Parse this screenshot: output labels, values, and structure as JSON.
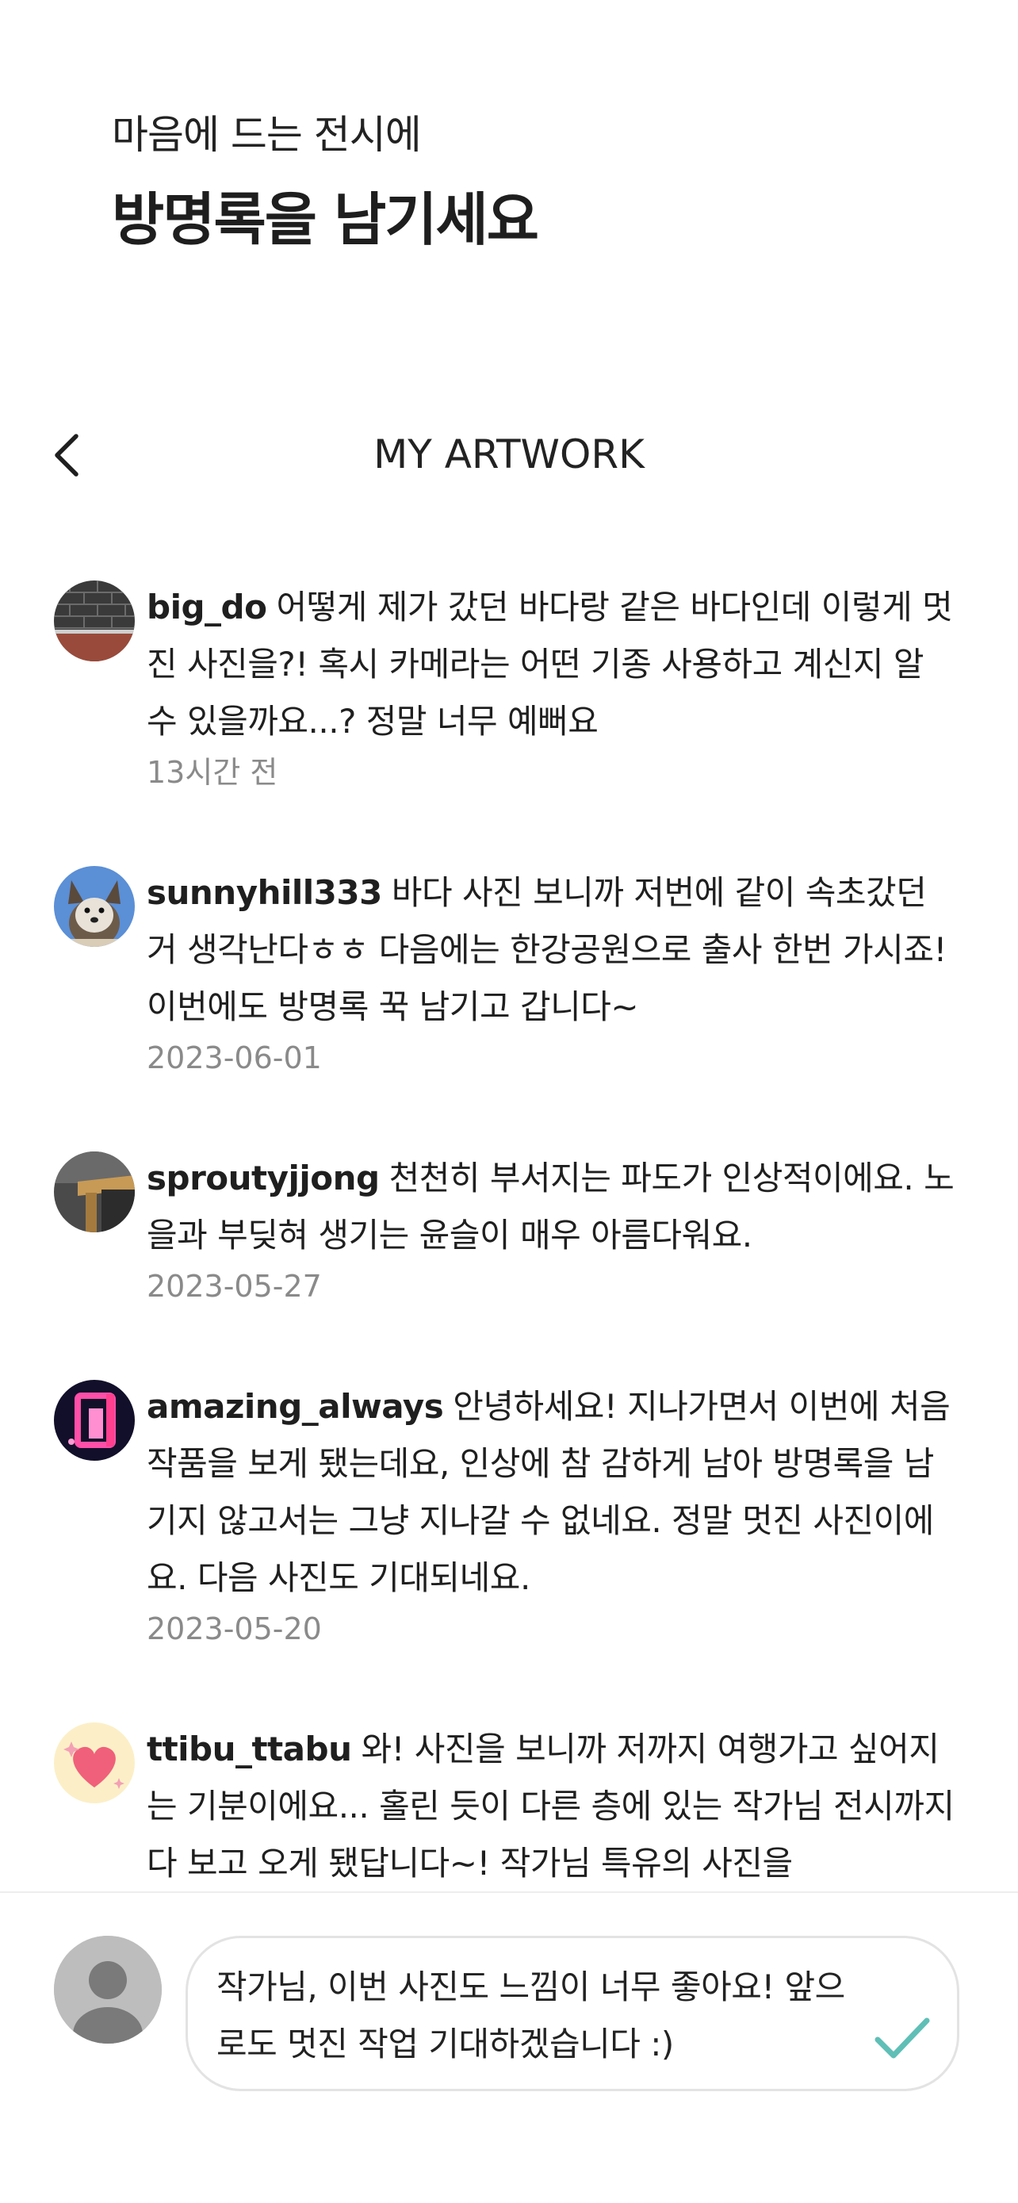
{
  "headline": {
    "subtitle": "마음에 드는 전시에",
    "title": "방명록을 남기세요"
  },
  "nav": {
    "title": "MY ARTWORK",
    "back_icon": "chevron-left-icon"
  },
  "comments": [
    {
      "username": "big_do",
      "text": "어떻게 제가 갔던 바다랑 같은 바다인데 이렇게 멋진 사진을?! 혹시 카메라는 어떤 기종 사용하고 계신지 알 수 있을까요...? 정말 너무 예뻐요",
      "time": "13시간 전",
      "avatar": "brick-wall-avatar"
    },
    {
      "username": "sunnyhill333",
      "text": "바다 사진 보니까 저번에 같이 속초갔던 거 생각난다ㅎㅎ 다음에는 한강공원으로 출사 한번 가시죠! 이번에도 방명록 꾹 남기고 갑니다~",
      "time": "2023-06-01",
      "avatar": "dog-avatar"
    },
    {
      "username": "sproutyjjong",
      "text": "천천히 부서지는 파도가 인상적이에요. 노을과 부딪혀 생기는 윤슬이 매우 아름다워요.",
      "time": "2023-05-27",
      "avatar": "wood-object-avatar"
    },
    {
      "username": "amazing_always",
      "text": "안녕하세요! 지나가면서 이번에 처음 작품을 보게 됐는데요, 인상에 참 감하게 남아 방명록을 남기지 않고서는 그냥 지나갈 수 없네요. 정말 멋진 사진이에요. 다음 사진도 기대되네요.",
      "time": "2023-05-20",
      "avatar": "neon-sign-avatar"
    },
    {
      "username": "ttibu_ttabu",
      "text": "와! 사진을 보니까 저까지 여행가고 싶어지는 기분이에요... 홀린 듯이 다른 층에 있는 작가님 전시까지 다 보고 오게 됐답니다~! 작가님 특유의 사진을",
      "time": "",
      "avatar": "heart-avatar"
    }
  ],
  "composer": {
    "text": "작가님, 이번 사진도 느낌이 너무 좋아요! 앞으로도 멋진 작업 기대하겠습니다 :)",
    "send_icon": "checkmark-icon",
    "accent_color": "#5fbfb6",
    "avatar": "default-user-avatar"
  }
}
